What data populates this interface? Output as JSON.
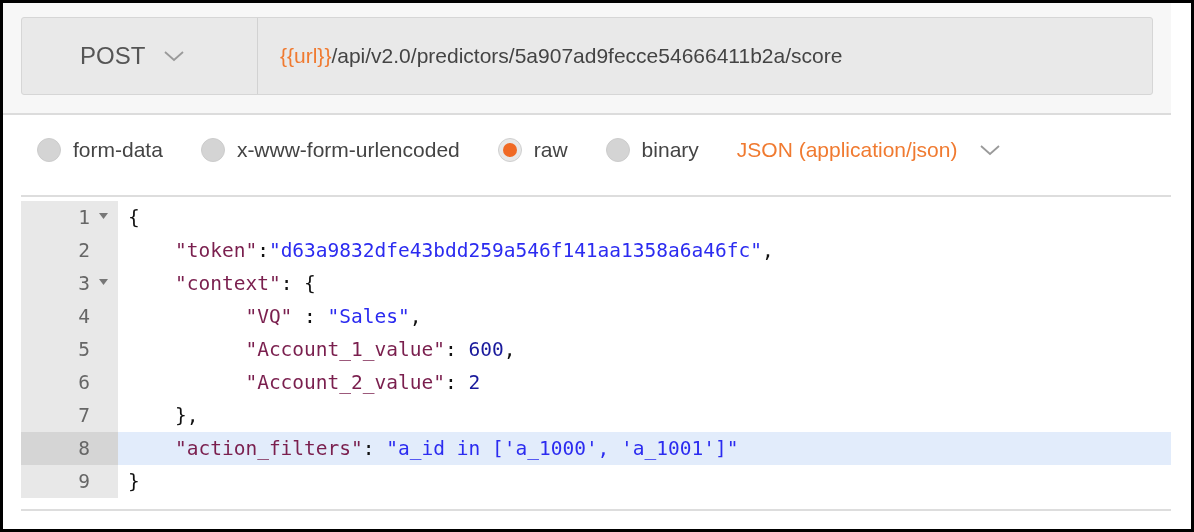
{
  "request": {
    "method": "POST",
    "url_variable": "{{url}}",
    "url_path": "/api/v2.0/predictors/5a907ad9fecce54666411b2a/score"
  },
  "body_types": [
    {
      "label": "form-data",
      "selected": false
    },
    {
      "label": "x-www-form-urlencoded",
      "selected": false
    },
    {
      "label": "raw",
      "selected": true
    },
    {
      "label": "binary",
      "selected": false
    }
  ],
  "content_type": "JSON (application/json)",
  "editor": {
    "lines": [
      {
        "number": "1",
        "foldable": true,
        "active": false,
        "tokens": [
          {
            "kind": "punct",
            "text": "{"
          }
        ]
      },
      {
        "number": "2",
        "foldable": false,
        "active": false,
        "tokens": [
          {
            "kind": "key",
            "text": "    \"token\""
          },
          {
            "kind": "punct",
            "text": ":"
          },
          {
            "kind": "string",
            "text": "\"d63a9832dfe43bdd259a546f141aa1358a6a46fc\""
          },
          {
            "kind": "punct",
            "text": ","
          }
        ]
      },
      {
        "number": "3",
        "foldable": true,
        "active": false,
        "tokens": [
          {
            "kind": "key",
            "text": "    \"context\""
          },
          {
            "kind": "punct",
            "text": ": {"
          }
        ]
      },
      {
        "number": "4",
        "foldable": false,
        "active": false,
        "tokens": [
          {
            "kind": "key",
            "text": "          \"VQ\""
          },
          {
            "kind": "punct",
            "text": " : "
          },
          {
            "kind": "string",
            "text": "\"Sales\""
          },
          {
            "kind": "punct",
            "text": ","
          }
        ]
      },
      {
        "number": "5",
        "foldable": false,
        "active": false,
        "tokens": [
          {
            "kind": "key",
            "text": "          \"Account_1_value\""
          },
          {
            "kind": "punct",
            "text": ": "
          },
          {
            "kind": "number",
            "text": "600"
          },
          {
            "kind": "punct",
            "text": ","
          }
        ]
      },
      {
        "number": "6",
        "foldable": false,
        "active": false,
        "tokens": [
          {
            "kind": "key",
            "text": "          \"Account_2_value\""
          },
          {
            "kind": "punct",
            "text": ": "
          },
          {
            "kind": "number",
            "text": "2"
          }
        ]
      },
      {
        "number": "7",
        "foldable": false,
        "active": false,
        "tokens": [
          {
            "kind": "punct",
            "text": "    },"
          }
        ]
      },
      {
        "number": "8",
        "foldable": false,
        "active": true,
        "tokens": [
          {
            "kind": "key",
            "text": "    \"action_filters\""
          },
          {
            "kind": "punct",
            "text": ": "
          },
          {
            "kind": "string",
            "text": "\"a_id in ['a_1000', 'a_1001']\""
          }
        ]
      },
      {
        "number": "9",
        "foldable": false,
        "active": false,
        "tokens": [
          {
            "kind": "punct",
            "text": "}"
          }
        ]
      }
    ]
  }
}
